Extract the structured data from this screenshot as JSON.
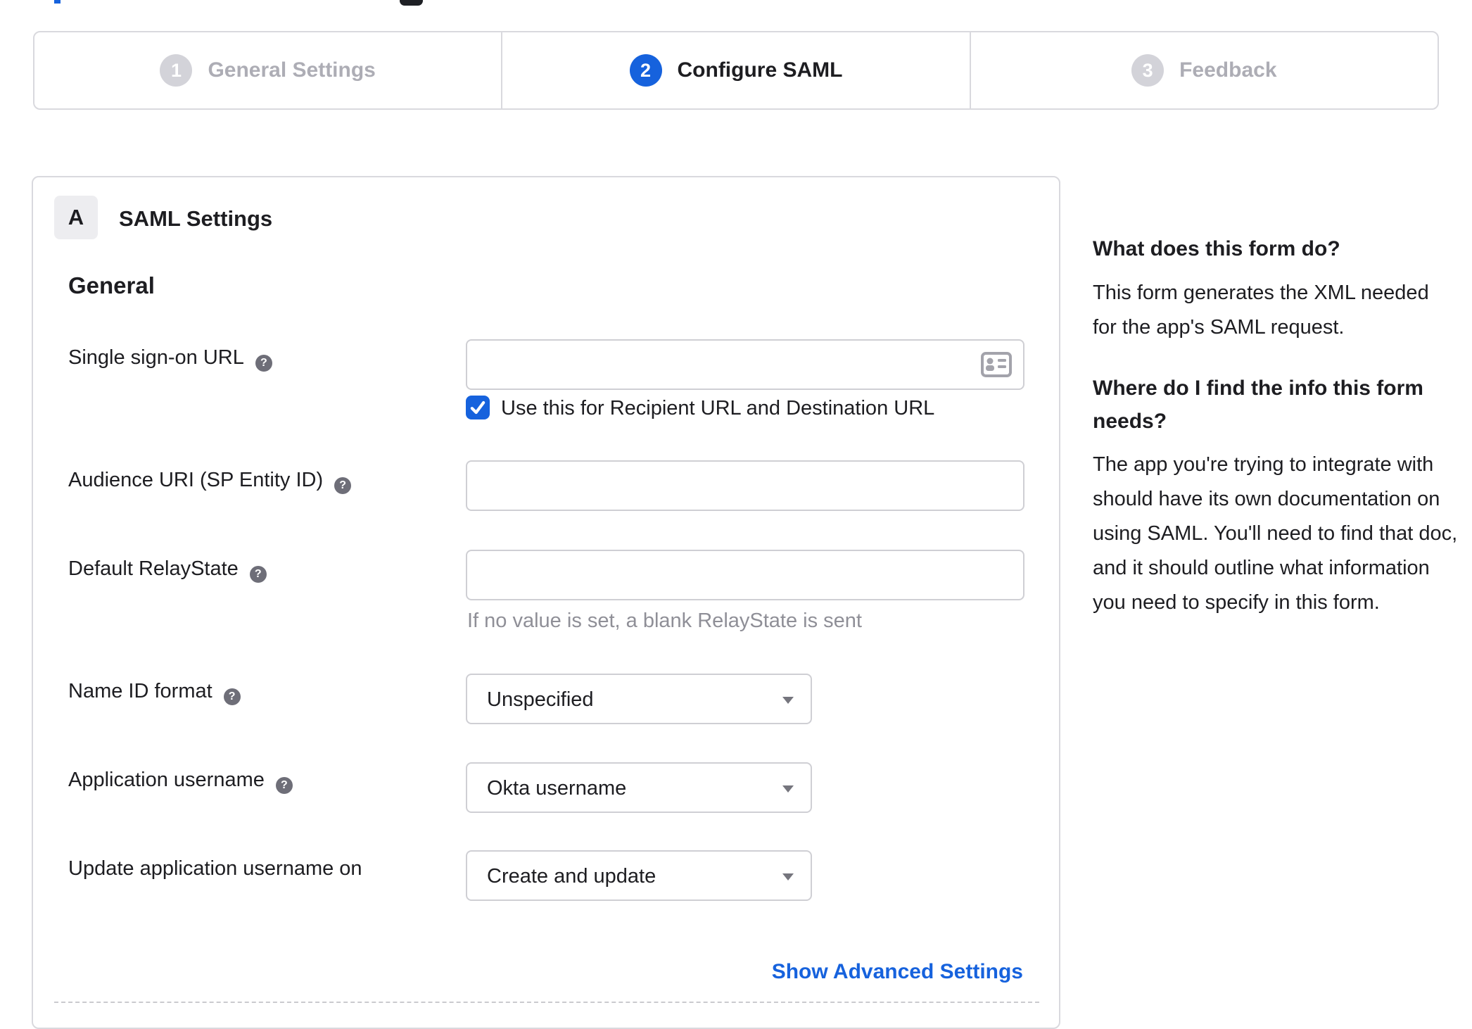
{
  "stepper": {
    "steps": [
      {
        "number": "1",
        "label": "General Settings",
        "state": "inactive"
      },
      {
        "number": "2",
        "label": "Configure SAML",
        "state": "active"
      },
      {
        "number": "3",
        "label": "Feedback",
        "state": "inactive"
      }
    ]
  },
  "panel": {
    "badge": "A",
    "title": "SAML Settings",
    "section_heading": "General",
    "fields": {
      "sso": {
        "label": "Single sign-on URL",
        "value": "",
        "checkbox_label": "Use this for Recipient URL and Destination URL",
        "checkbox_checked": true
      },
      "audience": {
        "label": "Audience URI (SP Entity ID)",
        "value": ""
      },
      "relay": {
        "label": "Default RelayState",
        "value": "",
        "hint": "If no value is set, a blank RelayState is sent"
      },
      "nameid": {
        "label": "Name ID format",
        "value": "Unspecified"
      },
      "appuser": {
        "label": "Application username",
        "value": "Okta username"
      },
      "update": {
        "label": "Update application username on",
        "value": "Create and update"
      }
    },
    "advanced_link": "Show Advanced Settings"
  },
  "sidebar": {
    "heading1": "What does this form do?",
    "para1": "This form generates the XML needed for the app's SAML request.",
    "heading2": "Where do I find the info this form needs?",
    "para2": "The app you're trying to integrate with should have its own documentation on using SAML. You'll need to find that doc, and it should outline what information you need to specify in this form."
  },
  "icons": {
    "help_glyph": "?"
  },
  "colors": {
    "accent_blue": "#1662dd",
    "text_dark": "#1d1d21",
    "inactive_gray": "#adadb5",
    "border_gray": "#d9d9de",
    "hint_gray": "#8f8f97"
  }
}
